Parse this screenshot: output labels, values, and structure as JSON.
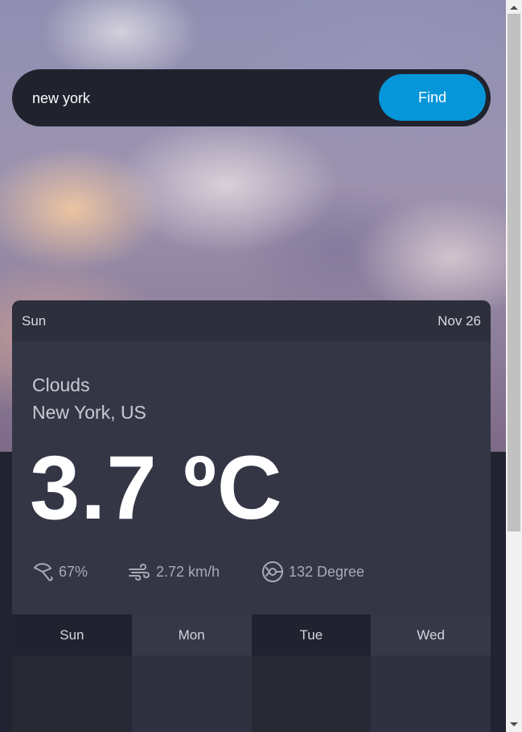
{
  "search": {
    "value": "new york",
    "button_label": "Find"
  },
  "current": {
    "day": "Sun",
    "date": "Nov 26",
    "condition": "Clouds",
    "location": "New York, US",
    "temperature": "3.7 ºC",
    "humidity": "67%",
    "wind": "2.72 km/h",
    "direction": "132 Degree"
  },
  "forecast": [
    {
      "day": "Sun"
    },
    {
      "day": "Mon"
    },
    {
      "day": "Tue"
    },
    {
      "day": "Wed"
    }
  ],
  "icons": {
    "humidity": "umbrella-icon",
    "wind": "wind-icon",
    "direction": "compass-icon"
  },
  "colors": {
    "accent": "#0596d9",
    "card": "#343646",
    "background": "#222330"
  }
}
